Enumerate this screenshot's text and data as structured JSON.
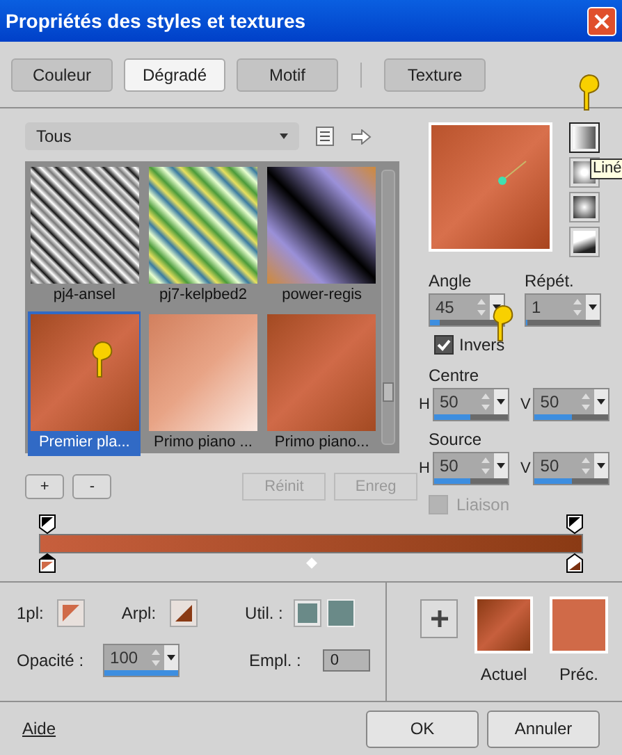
{
  "window": {
    "title": "Propriétés des styles et textures"
  },
  "tabs": [
    {
      "label": "Couleur",
      "selected": false
    },
    {
      "label": "Dégradé",
      "selected": true
    },
    {
      "label": "Motif",
      "selected": false
    },
    {
      "label": "Texture",
      "selected": false
    }
  ],
  "category_dropdown": {
    "value": "Tous"
  },
  "gallery": {
    "items": [
      {
        "name": "pj4-ansel",
        "kind": "silver-stripes",
        "selected": false
      },
      {
        "name": "pj7-kelpbed2",
        "kind": "green-stripes",
        "selected": false
      },
      {
        "name": "power-regis",
        "kind": "purple-black",
        "selected": false
      },
      {
        "name": "Premier pla...",
        "kind": "rust",
        "selected": true
      },
      {
        "name": "Primo piano ...",
        "kind": "rust-checker",
        "selected": false
      },
      {
        "name": "Primo piano...",
        "kind": "rust",
        "selected": false
      }
    ]
  },
  "gallery_buttons": {
    "add": "+",
    "remove": "-",
    "reset": "Réinit",
    "save": "Enreg"
  },
  "gradient_types": [
    {
      "kind": "linear",
      "selected": true
    },
    {
      "kind": "rectangular",
      "selected": false
    },
    {
      "kind": "radial",
      "selected": false
    },
    {
      "kind": "corner",
      "selected": false
    }
  ],
  "tooltip": "Liné",
  "angle": {
    "label": "Angle",
    "value": "45",
    "level": 0.125
  },
  "repeat": {
    "label": "Répét.",
    "value": "1",
    "level": 0.02
  },
  "invert": {
    "label": "Invers",
    "checked": true
  },
  "centre": {
    "label": "Centre",
    "h": {
      "label": "H",
      "value": "50",
      "level": 0.5
    },
    "v": {
      "label": "V",
      "value": "50",
      "level": 0.5
    }
  },
  "source": {
    "label": "Source",
    "h": {
      "label": "H",
      "value": "50",
      "level": 0.5
    },
    "v": {
      "label": "V",
      "value": "50",
      "level": 0.5
    }
  },
  "link": {
    "label": "Liaison",
    "checked": false
  },
  "foreground": {
    "label": "1pl:"
  },
  "background": {
    "label": "Arpl:"
  },
  "used": {
    "label": "Util. :"
  },
  "opacity": {
    "label": "Opacité :",
    "value": "100",
    "level": 1
  },
  "location": {
    "label": "Empl. :",
    "value": "0"
  },
  "current": {
    "label": "Actuel"
  },
  "previous": {
    "label": "Préc."
  },
  "help": "Aide",
  "ok": "OK",
  "cancel": "Annuler"
}
